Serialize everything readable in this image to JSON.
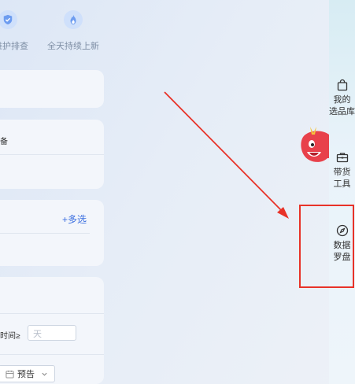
{
  "top_features": [
    {
      "label": "维护排查",
      "icon": "shield-check-icon"
    },
    {
      "label": "全天持续上新",
      "icon": "flame-icon"
    }
  ],
  "filters": {
    "card2_text": "备",
    "multi_select_label": "+多选",
    "time_label": "时间≥",
    "days_placeholder": "天",
    "preview_label": "预告"
  },
  "sidebar": {
    "items": [
      {
        "label": "我的\n选品库",
        "icon": "shopping-bag-icon"
      },
      {
        "label": "带货\n工具",
        "icon": "toolbox-icon"
      },
      {
        "label": "数据\n罗盘",
        "icon": "compass-icon"
      }
    ]
  },
  "colors": {
    "accent": "#3b6fe0",
    "highlight": "#e83228",
    "mascot": "#e8414b"
  }
}
